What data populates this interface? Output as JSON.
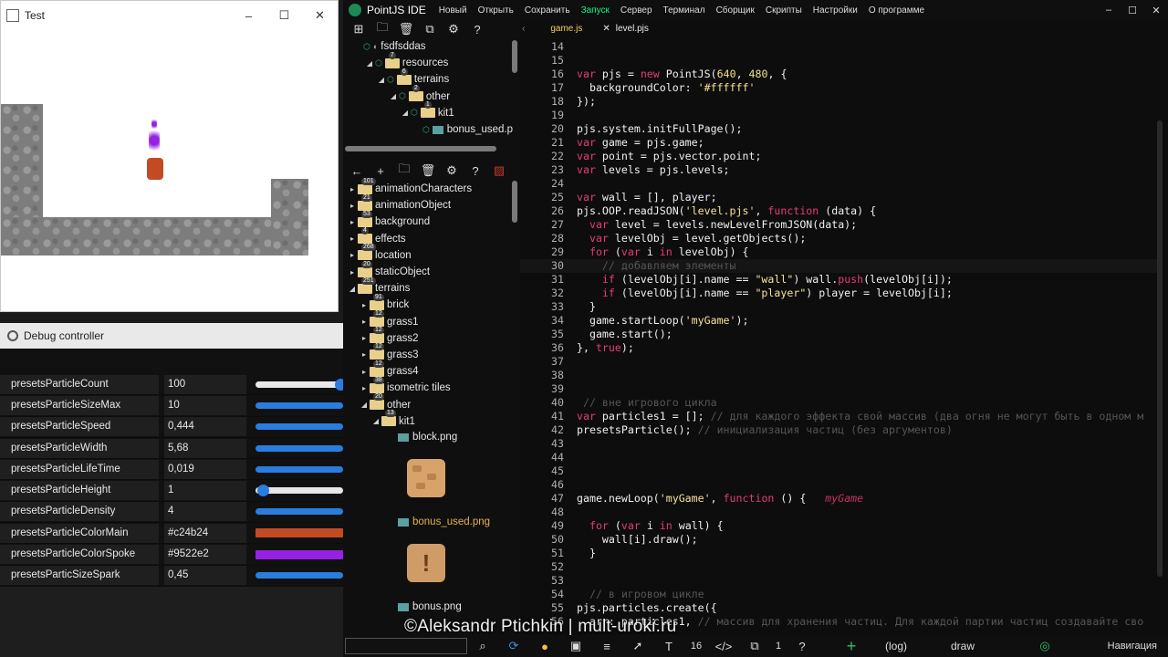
{
  "test_window": {
    "title": "Test",
    "controls": [
      "–",
      "☐",
      "✕"
    ]
  },
  "debug": {
    "title": "Debug controller",
    "params": [
      {
        "name": "presetsParticleCount",
        "value": "100",
        "slider": "thumb-right",
        "fill": 0.97
      },
      {
        "name": "presetsParticleSizeMax",
        "value": "10",
        "fill": 1
      },
      {
        "name": "presetsParticleSpeed",
        "value": "0,444",
        "fill": 1
      },
      {
        "name": "presetsParticleWidth",
        "value": "5,68",
        "fill": 1
      },
      {
        "name": "presetsParticleLifeTime",
        "value": "0,019",
        "fill": 1
      },
      {
        "name": "presetsParticleHeight",
        "value": "1",
        "fill": 0.08
      },
      {
        "name": "presetsParticleDensity",
        "value": "4",
        "fill": 1
      },
      {
        "name": "presetsParticleColorMain",
        "value": "#c24b24",
        "color": "#c24b24"
      },
      {
        "name": "presetsParticleColorSpoke",
        "value": "#9522e2",
        "color": "#9522e2"
      },
      {
        "name": "presetsParticSizeSpark",
        "value": "0,45",
        "fill": 1
      }
    ]
  },
  "ide": {
    "name": "PointJS IDE",
    "menu": [
      "Новый",
      "Открыть",
      "Сохранить",
      "Запуск",
      "Сервер",
      "Терминал",
      "Сборщик",
      "Скрипты",
      "Настройки",
      "О программе"
    ],
    "menu_highlight": "Запуск",
    "window_controls": [
      "–",
      "☐",
      "✕"
    ],
    "accent": "#00ff88"
  },
  "project_tree": [
    {
      "label": "fsdfsddas",
      "level": 0,
      "arrow": "",
      "kind": "root"
    },
    {
      "label": "resources",
      "level": 1,
      "arrow": "◢",
      "kind": "folder",
      "badge": "7"
    },
    {
      "label": "terrains",
      "level": 2,
      "arrow": "◢",
      "kind": "folder",
      "badge": "6"
    },
    {
      "label": "other",
      "level": 3,
      "arrow": "◢",
      "kind": "folder",
      "badge": "2"
    },
    {
      "label": "kit1",
      "level": 4,
      "arrow": "◢",
      "kind": "folder",
      "badge": "1"
    },
    {
      "label": "bonus_used.p",
      "level": 5,
      "arrow": "",
      "kind": "file"
    }
  ],
  "assets_tree": [
    {
      "label": "animationCharacters",
      "level": 0,
      "arrow": "▸",
      "badge": "101"
    },
    {
      "label": "animationObject",
      "level": 0,
      "arrow": "▸",
      "badge": "21"
    },
    {
      "label": "background",
      "level": 0,
      "arrow": "▸",
      "badge": "53"
    },
    {
      "label": "effects",
      "level": 0,
      "arrow": "▸",
      "badge": "4"
    },
    {
      "label": "location",
      "level": 0,
      "arrow": "▸",
      "badge": "268"
    },
    {
      "label": "staticObject",
      "level": 0,
      "arrow": "▸",
      "badge": "20"
    },
    {
      "label": "terrains",
      "level": 0,
      "arrow": "◢",
      "badge": "251"
    },
    {
      "label": "brick",
      "level": 1,
      "arrow": "▸",
      "badge": "91"
    },
    {
      "label": "grass1",
      "level": 1,
      "arrow": "▸",
      "badge": "12"
    },
    {
      "label": "grass2",
      "level": 1,
      "arrow": "▸",
      "badge": "12"
    },
    {
      "label": "grass3",
      "level": 1,
      "arrow": "▸",
      "badge": "12"
    },
    {
      "label": "grass4",
      "level": 1,
      "arrow": "▸",
      "badge": "12"
    },
    {
      "label": "isometric tiles",
      "level": 1,
      "arrow": "▸",
      "badge": "38"
    },
    {
      "label": "other",
      "level": 1,
      "arrow": "◢",
      "badge": "20"
    },
    {
      "label": "kit1",
      "level": 2,
      "arrow": "◢",
      "badge": "13"
    }
  ],
  "asset_files": [
    {
      "label": "block.png"
    },
    {
      "label": "bonus_used.png",
      "highlight": "#e8b050"
    },
    {
      "label": "bonus.png"
    }
  ],
  "editor": {
    "tabs": [
      {
        "label": "game.js",
        "active": true
      },
      {
        "label": "level.pjs",
        "active": false,
        "close": "✕"
      }
    ],
    "lines": [
      {
        "n": 14,
        "html": ""
      },
      {
        "n": 15,
        "html": ""
      },
      {
        "n": 16,
        "html": "<span class='kw'>var</span> pjs = <span class='kw'>new</span> PointJS(<span class='num'>640</span>, <span class='num'>480</span>, {"
      },
      {
        "n": 17,
        "html": "  backgroundColor: <span class='str'>'#ffffff'</span>"
      },
      {
        "n": 18,
        "html": "});"
      },
      {
        "n": 19,
        "html": ""
      },
      {
        "n": 20,
        "html": "pjs.system.initFullPage();"
      },
      {
        "n": 21,
        "html": "<span class='kw'>var</span> game = pjs.game;"
      },
      {
        "n": 22,
        "html": "<span class='kw'>var</span> point = pjs.vector.point;"
      },
      {
        "n": 23,
        "html": "<span class='kw'>var</span> levels = pjs.levels;"
      },
      {
        "n": 24,
        "html": ""
      },
      {
        "n": 25,
        "html": "<span class='kw'>var</span> wall = [], player;"
      },
      {
        "n": 26,
        "html": "pjs.OOP.readJSON(<span class='str'>'level.pjs'</span>, <span class='kw'>function</span> (data) {"
      },
      {
        "n": 27,
        "html": "  <span class='kw'>var</span> level = levels.newLevelFromJSON(data);"
      },
      {
        "n": 28,
        "html": "  <span class='kw'>var</span> levelObj = level.getObjects();"
      },
      {
        "n": 29,
        "html": "  <span class='kw'>for</span> (<span class='kw'>var</span> i <span class='kw'>in</span> levelObj) {"
      },
      {
        "n": 30,
        "html": "    <span class='cm'>// добавляем элементы</span>",
        "current": true
      },
      {
        "n": 31,
        "html": "    <span class='kw'>if</span> (levelObj[i].name == <span class='str'>\"wall\"</span>) wall.<span class='kw'>push</span>(levelObj[i]);"
      },
      {
        "n": 32,
        "html": "    <span class='kw'>if</span> (levelObj[i].name == <span class='str'>\"player\"</span>) player = levelObj[i];"
      },
      {
        "n": 33,
        "html": "  }"
      },
      {
        "n": 34,
        "html": "  game.startLoop(<span class='str'>'myGame'</span>);"
      },
      {
        "n": 35,
        "html": "  game.start();"
      },
      {
        "n": 36,
        "html": "}, <span class='kw'>true</span>);"
      },
      {
        "n": 37,
        "html": ""
      },
      {
        "n": 38,
        "html": ""
      },
      {
        "n": 39,
        "html": ""
      },
      {
        "n": 40,
        "html": " <span class='cm'>// вне игрового цикла</span>"
      },
      {
        "n": 41,
        "html": "<span class='kw'>var</span> particles1 = []; <span class='cm'>// для каждого эффекта свой массив (два огня не могут быть в одном м</span>"
      },
      {
        "n": 42,
        "html": "presetsParticle(); <span class='cm'>// инициализация частиц (без аргументов)</span>"
      },
      {
        "n": 43,
        "html": ""
      },
      {
        "n": 44,
        "html": ""
      },
      {
        "n": 45,
        "html": ""
      },
      {
        "n": 46,
        "html": ""
      },
      {
        "n": 47,
        "html": "game.newLoop(<span class='str'>'myGame'</span>, <span class='kw'>function</span> () {   <span class='cmgold'>myGame</span>"
      },
      {
        "n": 48,
        "html": ""
      },
      {
        "n": 49,
        "html": "  <span class='kw'>for</span> (<span class='kw'>var</span> i <span class='kw'>in</span> wall) {"
      },
      {
        "n": 50,
        "html": "    wall[i].draw();"
      },
      {
        "n": 51,
        "html": "  }"
      },
      {
        "n": 52,
        "html": ""
      },
      {
        "n": 53,
        "html": ""
      },
      {
        "n": 54,
        "html": "  <span class='cm'>// в игровом цикле</span>"
      },
      {
        "n": 55,
        "html": "pjs.particles.create({"
      },
      {
        "n": 56,
        "html": "  arr: particles1, <span class='cm'>// массив для хранения частиц. Для каждой партии частиц создавайте сво</span>"
      }
    ]
  },
  "bottom": {
    "line": "16",
    "col": "1",
    "log": "(log)",
    "func": "draw",
    "nav": "Навигация"
  },
  "watermark": "©Aleksandr Ptichkin | mult-uroki.ru"
}
